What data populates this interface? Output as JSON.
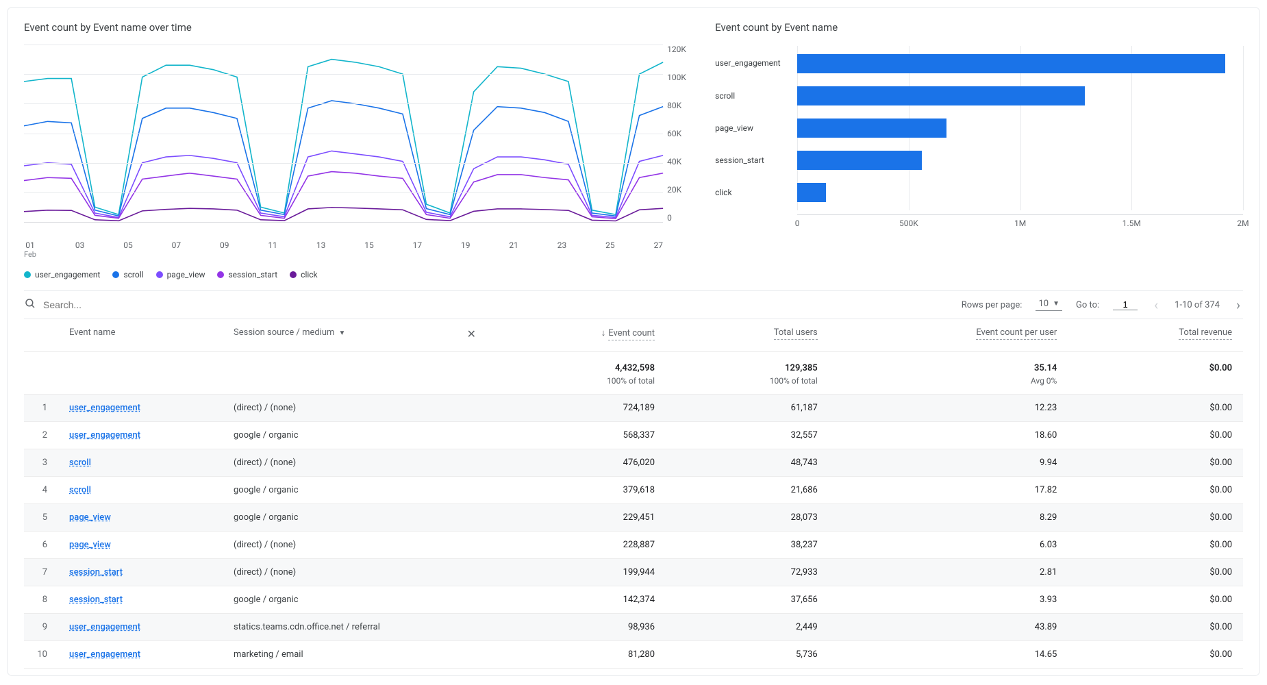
{
  "line_title": "Event count by Event name over time",
  "bar_title": "Event count by Event name",
  "search_placeholder": "Search...",
  "rows_per_page_label": "Rows per page:",
  "rows_per_page_value": "10",
  "goto_label": "Go to:",
  "goto_value": "1",
  "pagination_summary": "1-10 of 374",
  "legend": [
    {
      "label": "user_engagement",
      "color": "#12b5cb"
    },
    {
      "label": "scroll",
      "color": "#1a73e8"
    },
    {
      "label": "page_view",
      "color": "#7c4dff"
    },
    {
      "label": "session_start",
      "color": "#9334e6"
    },
    {
      "label": "click",
      "color": "#6a1b9a"
    }
  ],
  "chart_data": [
    {
      "type": "line",
      "title": "Event count by Event name over time",
      "xlabel": "Feb",
      "ylabel": "",
      "ylim": [
        0,
        120000
      ],
      "y_ticks": [
        "120K",
        "100K",
        "80K",
        "60K",
        "40K",
        "20K",
        "0"
      ],
      "x_ticks": [
        "01",
        "03",
        "05",
        "07",
        "09",
        "11",
        "13",
        "15",
        "17",
        "19",
        "21",
        "23",
        "25",
        "27"
      ],
      "x_sub": "Feb",
      "categories": [
        1,
        2,
        3,
        4,
        5,
        6,
        7,
        8,
        9,
        10,
        11,
        12,
        13,
        14,
        15,
        16,
        17,
        18,
        19,
        20,
        21,
        22,
        23,
        24,
        25,
        26,
        27,
        28
      ],
      "series": [
        {
          "name": "user_engagement",
          "color": "#12b5cb",
          "values": [
            95000,
            97000,
            97000,
            10000,
            5000,
            98000,
            106000,
            106000,
            103000,
            98000,
            10000,
            6000,
            105000,
            110000,
            108000,
            105000,
            100000,
            12000,
            6000,
            88000,
            105000,
            104000,
            100000,
            95000,
            8000,
            5000,
            100000,
            108000
          ]
        },
        {
          "name": "scroll",
          "color": "#1a73e8",
          "values": [
            65000,
            68000,
            67000,
            8000,
            4000,
            70000,
            77000,
            77000,
            74000,
            70000,
            8000,
            5000,
            77000,
            82000,
            80000,
            77000,
            73000,
            9000,
            5000,
            62000,
            78000,
            77000,
            74000,
            68000,
            6000,
            4000,
            72000,
            78000
          ]
        },
        {
          "name": "page_view",
          "color": "#7c4dff",
          "values": [
            38000,
            40000,
            39000,
            6000,
            3000,
            40000,
            44000,
            45000,
            43000,
            40000,
            6000,
            3500,
            44000,
            48000,
            46000,
            44000,
            41000,
            6500,
            3500,
            36000,
            44000,
            44000,
            42000,
            39000,
            4500,
            3000,
            41000,
            45000
          ]
        },
        {
          "name": "session_start",
          "color": "#9334e6",
          "values": [
            28000,
            30000,
            29500,
            4500,
            2500,
            29000,
            31000,
            33000,
            31000,
            29000,
            4500,
            2500,
            31000,
            34000,
            33000,
            31000,
            29500,
            5000,
            2500,
            27000,
            32000,
            32000,
            30000,
            28500,
            3500,
            2200,
            30000,
            33000
          ]
        },
        {
          "name": "click",
          "color": "#6a1b9a",
          "values": [
            7000,
            8000,
            7800,
            1500,
            800,
            7500,
            8500,
            9200,
            8800,
            8000,
            1500,
            900,
            8800,
            9800,
            9400,
            8800,
            8200,
            1700,
            900,
            7200,
            8800,
            8800,
            8400,
            7800,
            1200,
            700,
            8200,
            9200
          ]
        }
      ]
    },
    {
      "type": "bar",
      "orientation": "horizontal",
      "title": "Event count by Event name",
      "xlim": [
        0,
        2000000
      ],
      "x_ticks": [
        "0",
        "500K",
        "1M",
        "1.5M",
        "2M"
      ],
      "categories": [
        "user_engagement",
        "scroll",
        "page_view",
        "session_start",
        "click"
      ],
      "values": [
        1920000,
        1290000,
        670000,
        560000,
        130000
      ]
    }
  ],
  "table": {
    "columns": {
      "idx": "",
      "event_name": "Event name",
      "source_medium": "Session source / medium",
      "event_count": "Event count",
      "total_users": "Total users",
      "event_count_per_user": "Event count per user",
      "total_revenue": "Total revenue"
    },
    "totals": {
      "event_count": "4,432,598",
      "event_count_sub": "100% of total",
      "total_users": "129,385",
      "total_users_sub": "100% of total",
      "event_count_per_user": "35.14",
      "event_count_per_user_sub": "Avg 0%",
      "total_revenue": "$0.00",
      "total_revenue_sub": ""
    },
    "rows": [
      {
        "idx": "1",
        "event": "user_engagement",
        "source": "(direct) / (none)",
        "count": "724,189",
        "users": "61,187",
        "peruser": "12.23",
        "revenue": "$0.00"
      },
      {
        "idx": "2",
        "event": "user_engagement",
        "source": "google / organic",
        "count": "568,337",
        "users": "32,557",
        "peruser": "18.60",
        "revenue": "$0.00"
      },
      {
        "idx": "3",
        "event": "scroll",
        "source": "(direct) / (none)",
        "count": "476,020",
        "users": "48,743",
        "peruser": "9.94",
        "revenue": "$0.00"
      },
      {
        "idx": "4",
        "event": "scroll",
        "source": "google / organic",
        "count": "379,618",
        "users": "21,686",
        "peruser": "17.82",
        "revenue": "$0.00"
      },
      {
        "idx": "5",
        "event": "page_view",
        "source": "google / organic",
        "count": "229,451",
        "users": "28,073",
        "peruser": "8.29",
        "revenue": "$0.00"
      },
      {
        "idx": "6",
        "event": "page_view",
        "source": "(direct) / (none)",
        "count": "228,887",
        "users": "38,237",
        "peruser": "6.03",
        "revenue": "$0.00"
      },
      {
        "idx": "7",
        "event": "session_start",
        "source": "(direct) / (none)",
        "count": "199,944",
        "users": "72,933",
        "peruser": "2.81",
        "revenue": "$0.00"
      },
      {
        "idx": "8",
        "event": "session_start",
        "source": "google / organic",
        "count": "142,374",
        "users": "37,656",
        "peruser": "3.93",
        "revenue": "$0.00"
      },
      {
        "idx": "9",
        "event": "user_engagement",
        "source": "statics.teams.cdn.office.net / referral",
        "count": "98,936",
        "users": "2,449",
        "peruser": "43.89",
        "revenue": "$0.00"
      },
      {
        "idx": "10",
        "event": "user_engagement",
        "source": "marketing / email",
        "count": "81,280",
        "users": "5,736",
        "peruser": "14.65",
        "revenue": "$0.00"
      }
    ]
  }
}
